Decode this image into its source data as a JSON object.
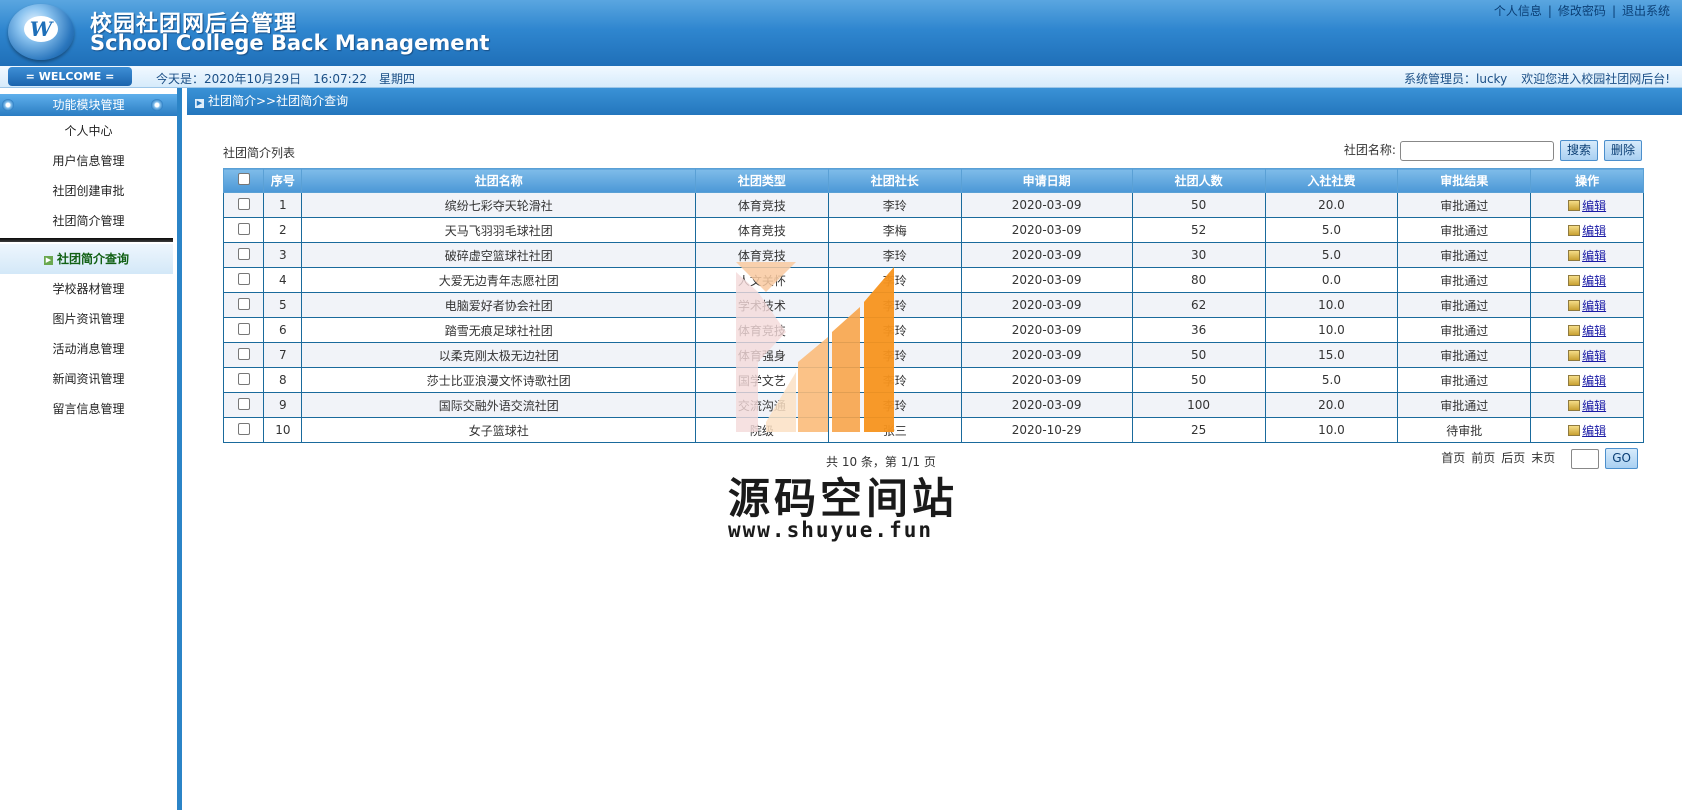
{
  "header": {
    "title_cn": "校园社团网后台管理",
    "title_en": "School College Back Management",
    "logo_letter": "W",
    "links": [
      "个人信息",
      "修改密码",
      "退出系统"
    ]
  },
  "welcome": {
    "button": "= WELCOME =",
    "today_label": "今天是：2020年10月29日",
    "time": "16:07:22",
    "weekday": "星期四",
    "admin": "系统管理员：lucky",
    "greeting": "欢迎您进入校园社团网后台!"
  },
  "sidebar": {
    "header": "功能模块管理",
    "items": [
      "个人中心",
      "用户信息管理",
      "社团创建审批",
      "社团简介管理",
      "社团简介查询",
      "学校器材管理",
      "图片资讯管理",
      "活动消息管理",
      "新闻资讯管理",
      "留言信息管理"
    ],
    "active_index": 4
  },
  "breadcrumb": "社团简介>>社团简介查询",
  "list_title": "社团简介列表",
  "search": {
    "label": "社团名称:",
    "value": "",
    "search_button": "搜索",
    "delete_button": "删除"
  },
  "table": {
    "headers": [
      "序号",
      "社团名称",
      "社团类型",
      "社团社长",
      "申请日期",
      "社团人数",
      "入社社费",
      "审批结果",
      "操作"
    ],
    "rows": [
      {
        "no": "1",
        "name": "缤纷七彩夺天轮滑社",
        "type": "体育竞技",
        "leader": "李玲",
        "date": "2020-03-09",
        "members": "50",
        "fee": "20.0",
        "result": "审批通过",
        "action": "编辑"
      },
      {
        "no": "2",
        "name": "天马飞羽羽毛球社团",
        "type": "体育竞技",
        "leader": "李梅",
        "date": "2020-03-09",
        "members": "52",
        "fee": "5.0",
        "result": "审批通过",
        "action": "编辑"
      },
      {
        "no": "3",
        "name": "破碎虚空篮球社社团",
        "type": "体育竞技",
        "leader": "李玲",
        "date": "2020-03-09",
        "members": "30",
        "fee": "5.0",
        "result": "审批通过",
        "action": "编辑"
      },
      {
        "no": "4",
        "name": "大爱无边青年志愿社团",
        "type": "人文关怀",
        "leader": "李玲",
        "date": "2020-03-09",
        "members": "80",
        "fee": "0.0",
        "result": "审批通过",
        "action": "编辑"
      },
      {
        "no": "5",
        "name": "电脑爱好者协会社团",
        "type": "学术技术",
        "leader": "李玲",
        "date": "2020-03-09",
        "members": "62",
        "fee": "10.0",
        "result": "审批通过",
        "action": "编辑"
      },
      {
        "no": "6",
        "name": "踏雪无痕足球社社团",
        "type": "体育竞技",
        "leader": "李玲",
        "date": "2020-03-09",
        "members": "36",
        "fee": "10.0",
        "result": "审批通过",
        "action": "编辑"
      },
      {
        "no": "7",
        "name": "以柔克刚太极无边社团",
        "type": "体育强身",
        "leader": "李玲",
        "date": "2020-03-09",
        "members": "50",
        "fee": "15.0",
        "result": "审批通过",
        "action": "编辑"
      },
      {
        "no": "8",
        "name": "莎士比亚浪漫文怀诗歌社团",
        "type": "国学文艺",
        "leader": "李玲",
        "date": "2020-03-09",
        "members": "50",
        "fee": "5.0",
        "result": "审批通过",
        "action": "编辑"
      },
      {
        "no": "9",
        "name": "国际交融外语交流社团",
        "type": "交流沟通",
        "leader": "李玲",
        "date": "2020-03-09",
        "members": "100",
        "fee": "20.0",
        "result": "审批通过",
        "action": "编辑"
      },
      {
        "no": "10",
        "name": "女子篮球社",
        "type": "院级",
        "leader": "张三",
        "date": "2020-10-29",
        "members": "25",
        "fee": "10.0",
        "result": "待审批",
        "action": "编辑"
      }
    ]
  },
  "summary": "共 10 条，第 1/1 页",
  "pager": {
    "first": "首页",
    "prev": "前页",
    "next": "后页",
    "last": "末页",
    "page_value": "",
    "go_button": "GO"
  },
  "watermark": {
    "title": "源码空间站",
    "url": "www.shuyue.fun"
  },
  "colors": {
    "header_blue": "#2f86cf",
    "table_head": "#4b97d6",
    "active_menu_text": "#116014",
    "watermark_orange": "#f7931e"
  }
}
